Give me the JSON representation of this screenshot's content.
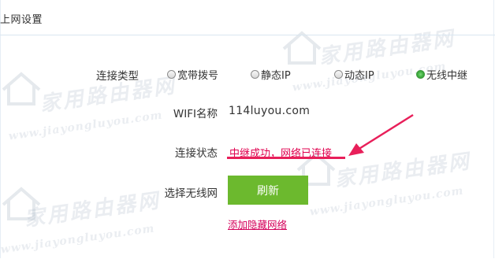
{
  "section": {
    "title": "上网设置"
  },
  "connection_type": {
    "label": "连接类型",
    "options": [
      {
        "label": "宽带拨号",
        "selected": false
      },
      {
        "label": "静态IP",
        "selected": false
      },
      {
        "label": "动态IP",
        "selected": false
      },
      {
        "label": "无线中继",
        "selected": true
      }
    ]
  },
  "wifi": {
    "label": "WIFI名称",
    "value": "114luyou.com"
  },
  "status": {
    "label": "连接状态",
    "value": "中继成功，网络已连接"
  },
  "wireless": {
    "label": "选择无线网",
    "refresh_label": "刷新",
    "hidden_network_link": "添加隐藏网络"
  },
  "watermark": {
    "cn": "家用路由器网",
    "en": "www.jiayongluyou.com"
  },
  "colors": {
    "accent_green": "#6cb92e",
    "status_red": "#e0004f",
    "annotation_red": "#e81f5a"
  }
}
